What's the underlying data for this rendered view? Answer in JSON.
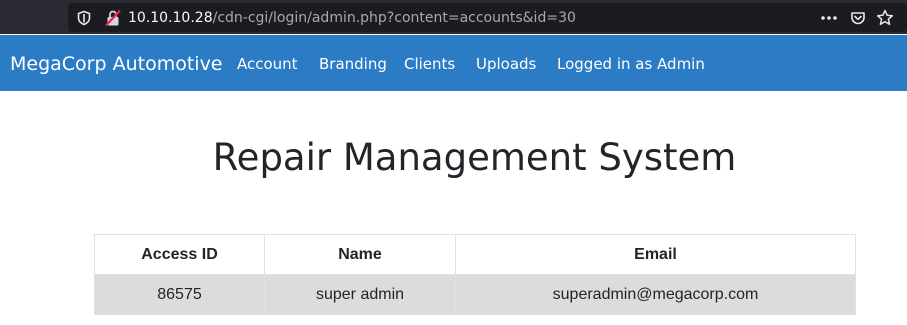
{
  "browser": {
    "url_host": "10.10.10.28",
    "url_path": "/cdn-cgi/login/admin.php?content=accounts&id=30",
    "icons": [
      "shield-icon",
      "insecure-lock-icon",
      "more-actions-icon",
      "pocket-icon",
      "bookmark-star-icon"
    ],
    "colors": {
      "toolbar": "#2b2a33",
      "url_field": "#1c1b22",
      "insecure_strike": "#e22850"
    }
  },
  "navbar": {
    "brand": "MegaCorp Automotive",
    "links": [
      "Account",
      "Branding",
      "Clients",
      "Uploads",
      "Logged in as Admin"
    ],
    "color": "#2c7bc5"
  },
  "main": {
    "title": "Repair Management System"
  },
  "table": {
    "headers": [
      "Access ID",
      "Name",
      "Email"
    ],
    "rows": [
      [
        "86575",
        "super admin",
        "superadmin@megacorp.com"
      ]
    ],
    "row_color": "#dcdcdc"
  }
}
